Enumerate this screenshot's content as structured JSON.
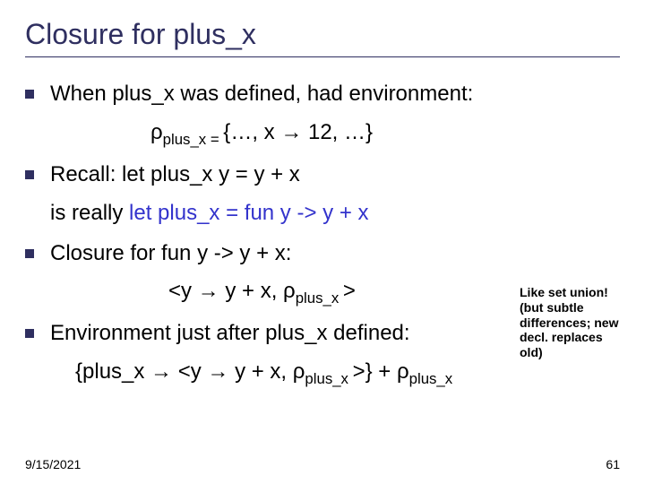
{
  "title": "Closure for plus_x",
  "bullets": {
    "b1": "When plus_x was defined, had environment:",
    "b2": "Recall: let plus_x y = y + x",
    "b3a": "is really ",
    "b3b": "let plus_x = fun y -> y + x",
    "b4": "Closure for fun y -> y + x:",
    "b5": "Environment just after plus_x defined:"
  },
  "eq": {
    "rho1_pre": "ρ",
    "rho1_sub": "plus_x = ",
    "rho1_post": "{…, x → 12, …}",
    "closure_pre": "<y → y + x, ",
    "closure_rho": "ρ",
    "closure_sub": "plus_x ",
    "closure_post": ">",
    "final_a": "{plus_x → <y → y + x, ",
    "final_rho1": "ρ",
    "final_sub1": "plus_x ",
    "final_b": ">} + ",
    "final_rho2": "ρ",
    "final_sub2": "plus_x"
  },
  "note": "Like set union!\n(but subtle differences; new decl. replaces old)",
  "footer_date": "9/15/2021",
  "footer_page": "61",
  "chart_data": null
}
